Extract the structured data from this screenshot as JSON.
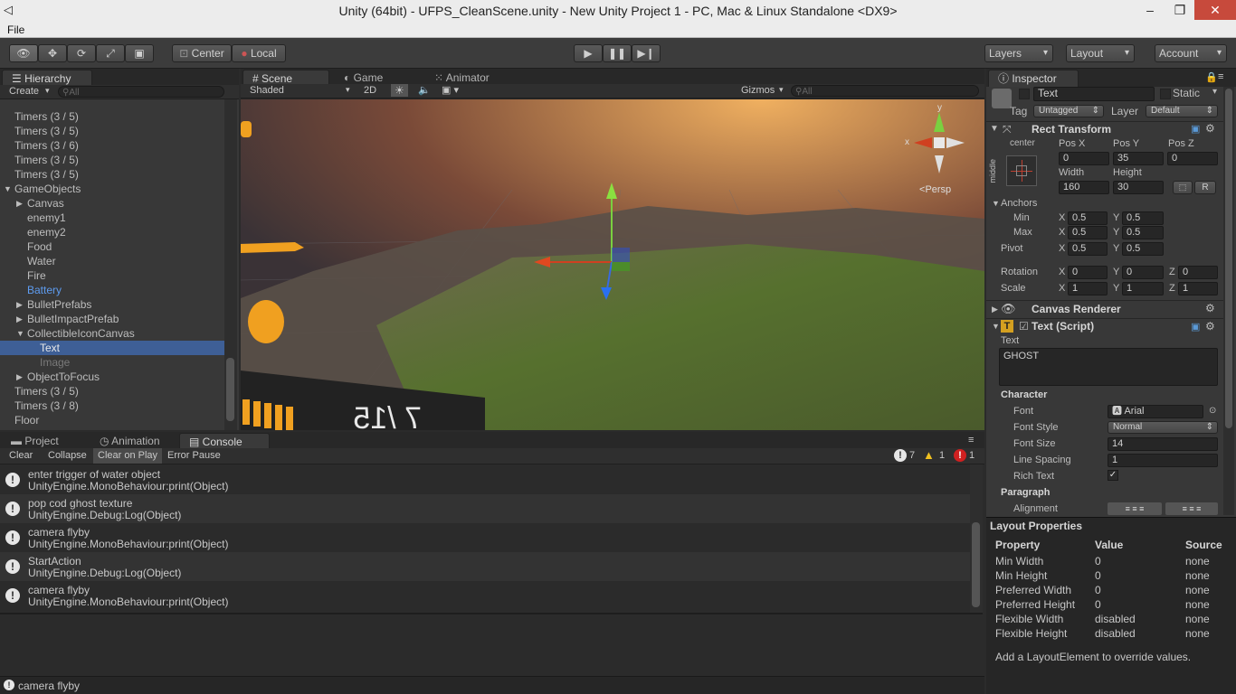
{
  "window": {
    "title": "Unity (64bit) - UFPS_CleanScene.unity - New Unity Project 1 - PC, Mac & Linux Standalone <DX9>",
    "minimize": "–",
    "restore": "❐",
    "close": "✕"
  },
  "menu": {
    "file": "File"
  },
  "toolbar": {
    "pivot_center": "Center",
    "pivot_local": "Local",
    "layers": "Layers",
    "layout": "Layout",
    "account": "Account"
  },
  "hierarchy": {
    "tab": "Hierarchy",
    "create": "Create",
    "search_placeholder": "All",
    "items": [
      {
        "label": "Timers (3 / 5)",
        "indent": 0,
        "state": "normal"
      },
      {
        "label": "Timers (3 / 5)",
        "indent": 0,
        "state": "normal"
      },
      {
        "label": "Timers (3 / 6)",
        "indent": 0,
        "state": "normal"
      },
      {
        "label": "Timers (3 / 5)",
        "indent": 0,
        "state": "normal"
      },
      {
        "label": "Timers (3 / 5)",
        "indent": 0,
        "state": "normal"
      },
      {
        "label": "GameObjects",
        "indent": 0,
        "state": "expanded"
      },
      {
        "label": "Canvas",
        "indent": 1,
        "state": "collapsed"
      },
      {
        "label": "enemy1",
        "indent": 1,
        "state": "normal"
      },
      {
        "label": "enemy2",
        "indent": 1,
        "state": "normal"
      },
      {
        "label": "Food",
        "indent": 1,
        "state": "normal"
      },
      {
        "label": "Water",
        "indent": 1,
        "state": "normal"
      },
      {
        "label": "Fire",
        "indent": 1,
        "state": "normal"
      },
      {
        "label": "Battery",
        "indent": 1,
        "state": "prefab"
      },
      {
        "label": "BulletPrefabs",
        "indent": 1,
        "state": "collapsed"
      },
      {
        "label": "BulletImpactPrefab",
        "indent": 1,
        "state": "collapsed"
      },
      {
        "label": "CollectibleIconCanvas",
        "indent": 1,
        "state": "expanded"
      },
      {
        "label": "Text",
        "indent": 2,
        "state": "selected"
      },
      {
        "label": "Image",
        "indent": 2,
        "state": "disabled"
      },
      {
        "label": "ObjectToFocus",
        "indent": 1,
        "state": "collapsed"
      },
      {
        "label": "Timers (3 / 5)",
        "indent": 0,
        "state": "normal"
      },
      {
        "label": "Timers (3 / 8)",
        "indent": 0,
        "state": "normal"
      },
      {
        "label": "Floor",
        "indent": 0,
        "state": "normal"
      }
    ]
  },
  "scene": {
    "tabs": {
      "scene": "Scene",
      "game": "Game",
      "animator": "Animator"
    },
    "shading": "Shaded",
    "mode_2d": "2D",
    "gizmos": "Gizmos",
    "search_placeholder": "All",
    "persp": "Persp",
    "axis_x": "x",
    "axis_y": "y",
    "overlay_text": "7 /15"
  },
  "console": {
    "tabs": {
      "project": "Project",
      "animation": "Animation",
      "console": "Console"
    },
    "buttons": {
      "clear": "Clear",
      "collapse": "Collapse",
      "clear_on_play": "Clear on Play",
      "error_pause": "Error Pause"
    },
    "counts": {
      "info": "7",
      "warning": "1",
      "error": "1"
    },
    "entries": [
      {
        "line1": "enter trigger of water object",
        "line2": "UnityEngine.MonoBehaviour:print(Object)"
      },
      {
        "line1": "pop cod ghost texture",
        "line2": "UnityEngine.Debug:Log(Object)"
      },
      {
        "line1": "camera flyby",
        "line2": "UnityEngine.MonoBehaviour:print(Object)"
      },
      {
        "line1": "StartAction",
        "line2": "UnityEngine.Debug:Log(Object)"
      },
      {
        "line1": "camera flyby",
        "line2": "UnityEngine.MonoBehaviour:print(Object)"
      }
    ],
    "status": "camera flyby"
  },
  "inspector": {
    "tab": "Inspector",
    "name": "Text",
    "static": "Static",
    "tag_label": "Tag",
    "tag": "Untagged",
    "layer_label": "Layer",
    "layer": "Default",
    "rect": {
      "title": "Rect Transform",
      "anchor_label": "center",
      "middle_label": "middle",
      "posx_label": "Pos X",
      "posy_label": "Pos Y",
      "posz_label": "Pos Z",
      "posx": "0",
      "posy": "35",
      "posz": "0",
      "width_label": "Width",
      "height_label": "Height",
      "width": "160",
      "height": "30",
      "r_button": "R",
      "anchors": "Anchors",
      "min": "Min",
      "max": "Max",
      "min_x": "0.5",
      "min_y": "0.5",
      "max_x": "0.5",
      "max_y": "0.5",
      "pivot": "Pivot",
      "pivot_x": "0.5",
      "pivot_y": "0.5",
      "rotation": "Rotation",
      "rot_x": "0",
      "rot_y": "0",
      "rot_z": "0",
      "scale": "Scale",
      "scale_x": "1",
      "scale_y": "1",
      "scale_z": "1",
      "x": "X",
      "y": "Y",
      "z": "Z"
    },
    "canvas_renderer": "Canvas Renderer",
    "text_script": {
      "title": "Text (Script)",
      "text_label": "Text",
      "text_value": "GHOST",
      "character": "Character",
      "font_label": "Font",
      "font": "Arial",
      "font_style_label": "Font Style",
      "font_style": "Normal",
      "font_size_label": "Font Size",
      "font_size": "14",
      "line_spacing_label": "Line Spacing",
      "line_spacing": "1",
      "rich_text_label": "Rich Text",
      "rich_text": "✓",
      "paragraph": "Paragraph",
      "alignment_label": "Alignment"
    }
  },
  "layout_properties": {
    "title": "Layout Properties",
    "headers": {
      "property": "Property",
      "value": "Value",
      "source": "Source"
    },
    "rows": [
      {
        "property": "Min Width",
        "value": "0",
        "source": "none"
      },
      {
        "property": "Min Height",
        "value": "0",
        "source": "none"
      },
      {
        "property": "Preferred Width",
        "value": "0",
        "source": "none"
      },
      {
        "property": "Preferred Height",
        "value": "0",
        "source": "none"
      },
      {
        "property": "Flexible Width",
        "value": "disabled",
        "source": "none"
      },
      {
        "property": "Flexible Height",
        "value": "disabled",
        "source": "none"
      }
    ],
    "footer": "Add a LayoutElement to override values."
  }
}
